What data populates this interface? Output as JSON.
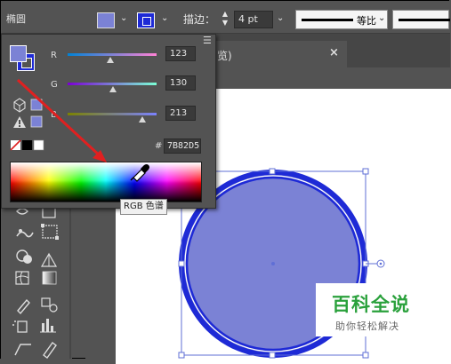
{
  "control_bar": {
    "shape_name": "椭圆",
    "stroke_label": "描边：",
    "stroke_weight": "4 pt",
    "profile_label": "等比"
  },
  "document_tab": {
    "title_fragment": "览)",
    "close_glyph": "×"
  },
  "color_panel": {
    "fill_color": "#7b82d5",
    "stroke_color": "#1e2ad6",
    "channels": [
      {
        "label": "R",
        "value": "123",
        "fraction": 0.48
      },
      {
        "label": "G",
        "value": "130",
        "fraction": 0.51
      },
      {
        "label": "B",
        "value": "213",
        "fraction": 0.84
      }
    ],
    "hex_symbol": "#",
    "hex_value": "7B82D5",
    "tooltip": "RGB 色谱"
  },
  "canvas": {
    "ellipse_fill": "#7b82d5",
    "ellipse_stroke": "#1e2ad6"
  },
  "watermark": {
    "title": "百科全说",
    "subtitle": "助你轻松解决"
  },
  "annotation": {
    "arrow_color": "#e02020"
  }
}
